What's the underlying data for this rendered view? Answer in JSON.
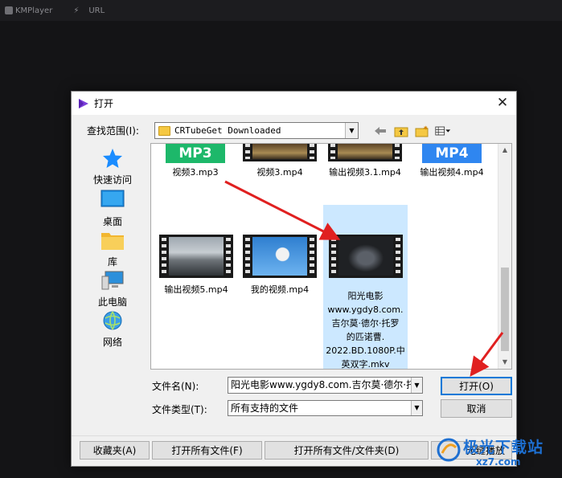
{
  "app": {
    "name": "KMPlayer",
    "url_label": "URL"
  },
  "dialog": {
    "title": "打开",
    "lookin_label": "查找范围(I):",
    "lookin_value": "CRTubeGet Downloaded",
    "places": [
      {
        "label": "快速访问",
        "icon": "quick-access-star-icon"
      },
      {
        "label": "桌面",
        "icon": "desktop-icon"
      },
      {
        "label": "库",
        "icon": "library-folder-icon"
      },
      {
        "label": "此电脑",
        "icon": "this-pc-icon"
      },
      {
        "label": "网络",
        "icon": "network-globe-icon"
      }
    ],
    "files": [
      {
        "name": "视频3.mp3",
        "badge": "MP3",
        "badge_color": "#1db86a"
      },
      {
        "name": "视频3.mp4"
      },
      {
        "name": "输出视频3.1.mp4"
      },
      {
        "name": "输出视频4.mp4",
        "badge": "MP4",
        "badge_color": "#2f86f0"
      },
      {
        "name": "输出视频5.mp4"
      },
      {
        "name": "我的视频.mp4"
      },
      {
        "name_lines": [
          "阳光电影",
          "www.ygdy8.com.",
          "吉尔莫·德尔·托罗",
          "的匹诺曹.",
          "2022.BD.1080P.中",
          "英双字.mkv"
        ],
        "selected": true
      }
    ],
    "filename_label": "文件名(N):",
    "filename_value": "阳光电影www.ygdy8.com.吉尔莫·德尔·托",
    "filetype_label": "文件类型(T):",
    "filetype_value": "所有支持的文件",
    "open_button": "打开(O)",
    "cancel_button": "取消",
    "favorites_button": "收藏夹(A)",
    "open_all_files_button": "打开所有文件(F)",
    "open_all_files_folders_button": "打开所有文件/文件夹(D)",
    "seamless_button": "无缝播放"
  },
  "watermark": {
    "text": "极光下载站",
    "sub": "xz7.com"
  },
  "colors": {
    "selection": "#cce8ff",
    "arrow": "#e02020",
    "accent": "#0078d7"
  }
}
